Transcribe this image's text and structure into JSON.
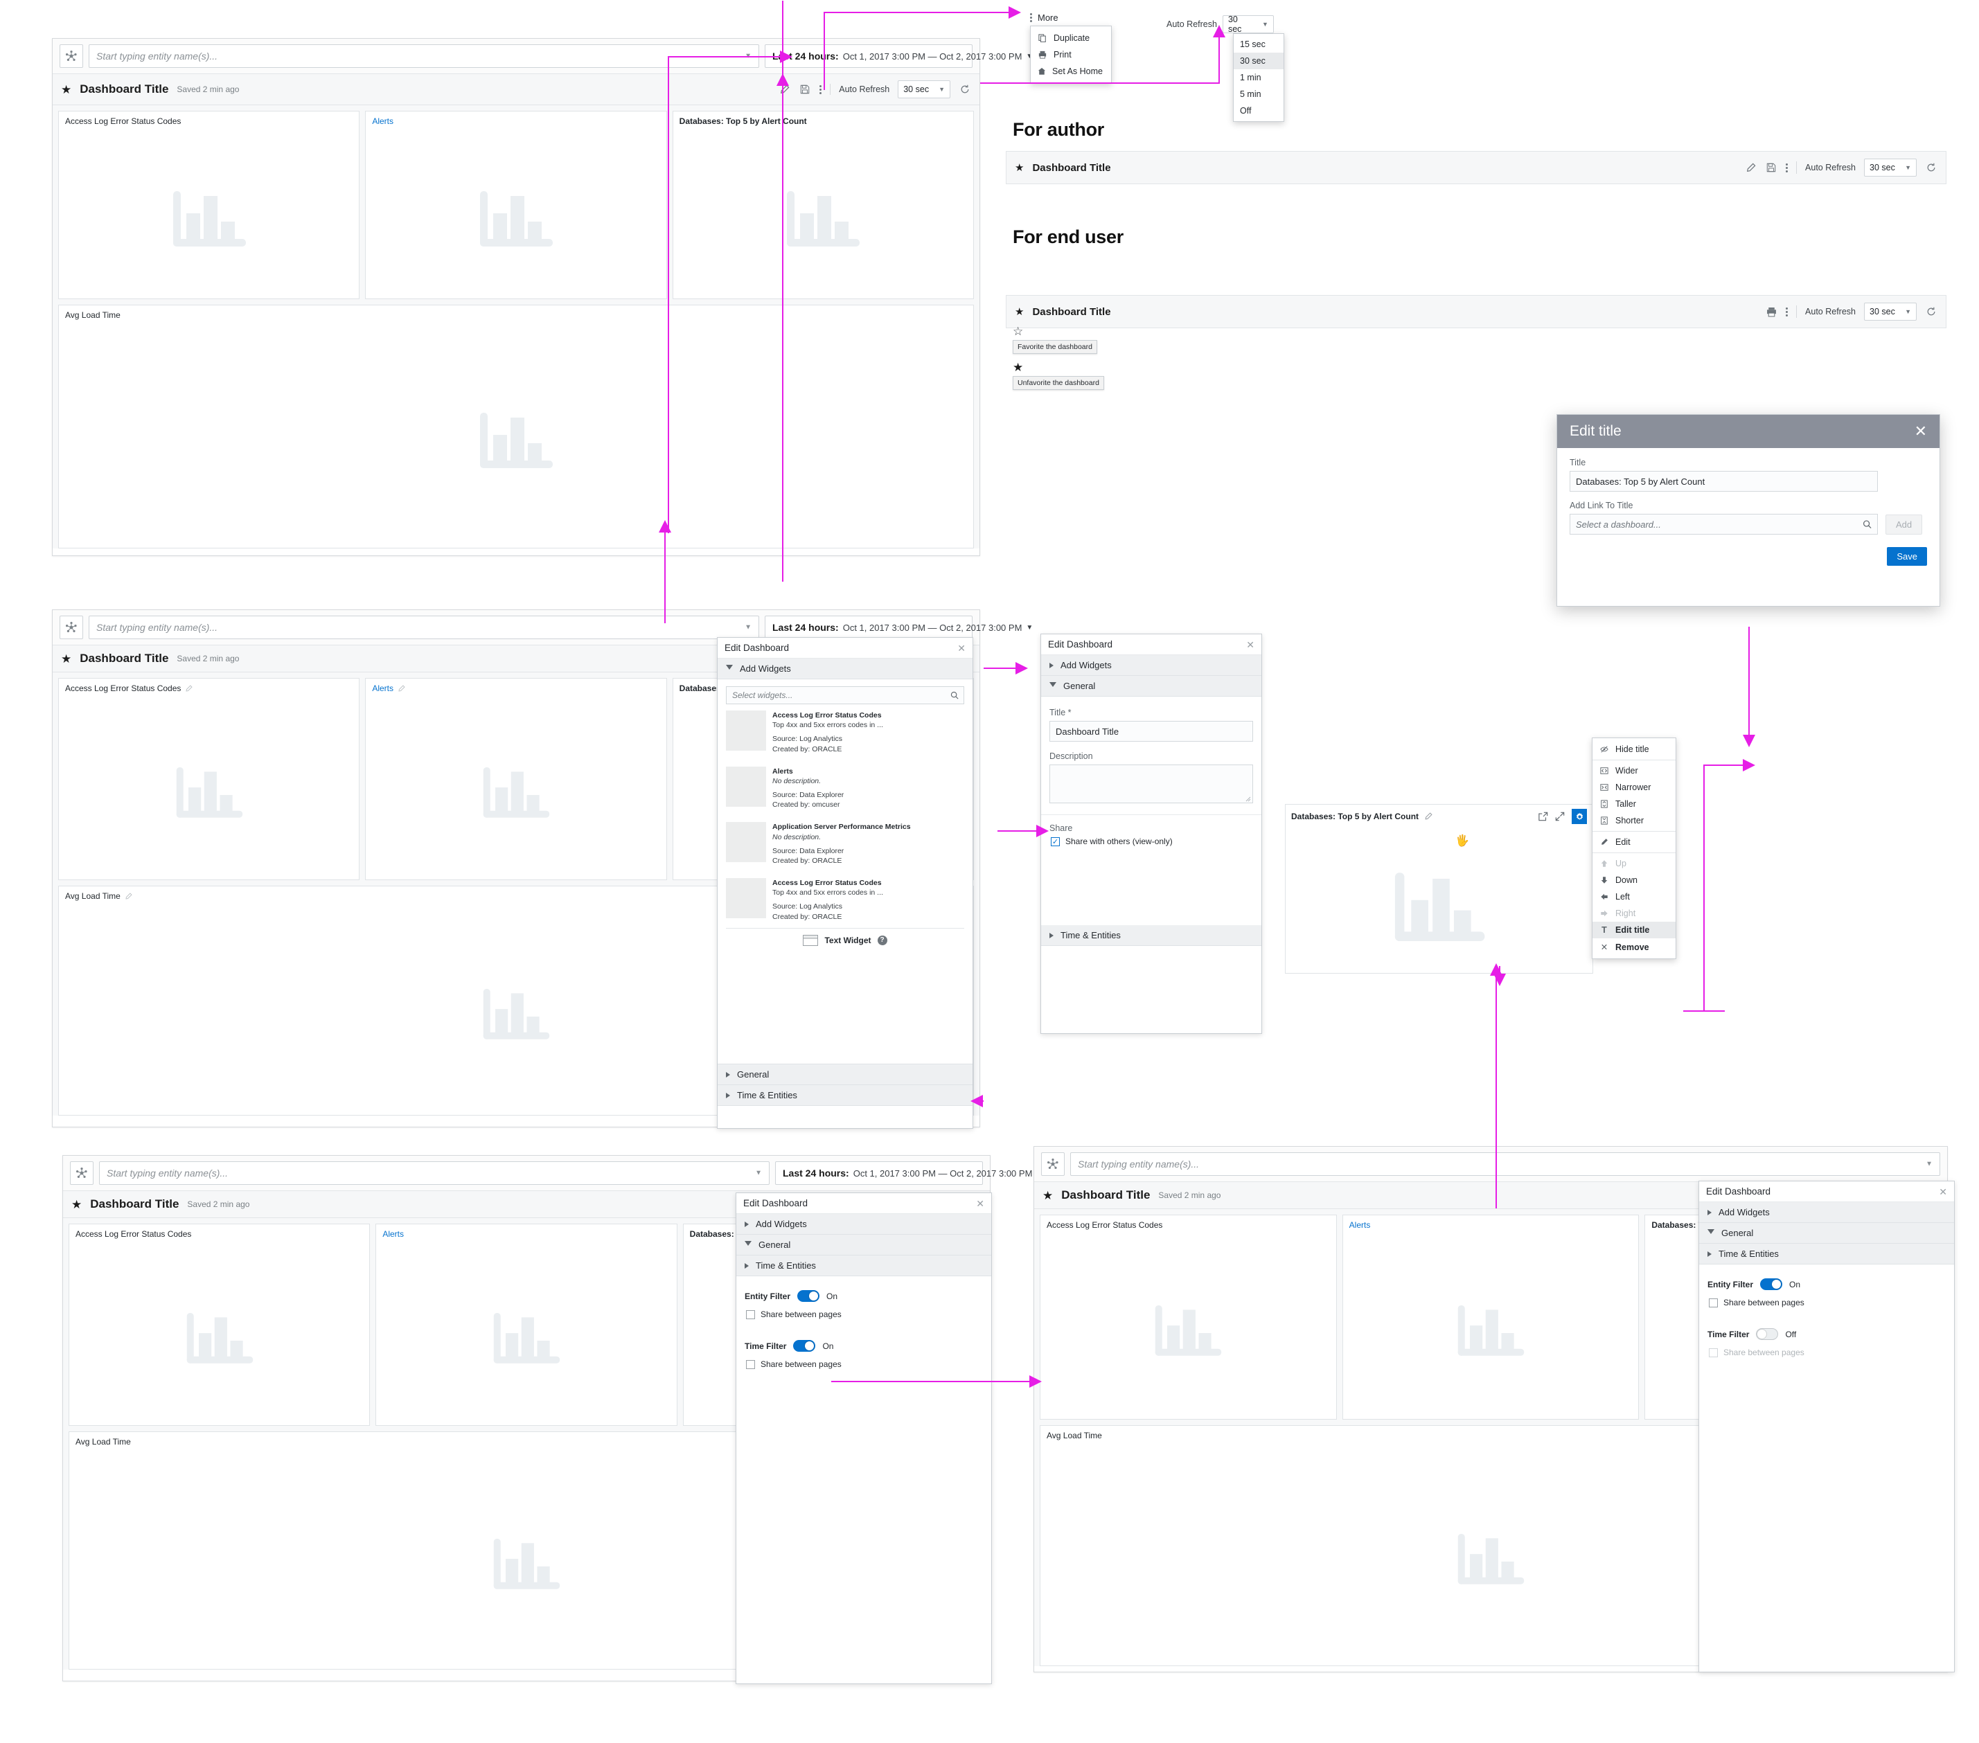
{
  "filter_bar": {
    "entity_icon": "topology-icon",
    "entity_placeholder": "Start typing entity name(s)...",
    "time_prefix": "Last 24 hours:",
    "time_range": "Oct 1, 2017 3:00 PM — Oct 2, 2017 3:00 PM"
  },
  "dashboard": {
    "title": "Dashboard Title",
    "saved": "Saved 2 min ago",
    "star_icon": "star-filled-icon",
    "edit_icon": "pencil-icon",
    "save_icon": "floppy-disk-icon",
    "more_icon": "kebab-icon",
    "print_icon": "printer-icon",
    "refresh_icon": "refresh-icon",
    "auto_refresh_label": "Auto Refresh",
    "auto_refresh_value": "30 sec"
  },
  "widgets": [
    {
      "title": "Access Log Error Status Codes",
      "style": "plain"
    },
    {
      "title": "Alerts",
      "style": "link"
    },
    {
      "title": "Databases: Top 5 by Alert Count",
      "style": "bold"
    },
    {
      "title": "Avg Load Time",
      "style": "plain"
    }
  ],
  "more_menu": {
    "label": "More",
    "icon": "kebab-icon",
    "items": [
      {
        "label": "Duplicate",
        "icon": "duplicate-icon"
      },
      {
        "label": "Print",
        "icon": "printer-icon"
      },
      {
        "label": "Set As Home",
        "icon": "home-icon"
      }
    ]
  },
  "auto_refresh_menu": {
    "label": "Auto Refresh",
    "value": "30 sec",
    "options": [
      "15 sec",
      "30 sec",
      "1 min",
      "5 min",
      "Off"
    ],
    "selected": "30 sec"
  },
  "sections": {
    "for_author": "For author",
    "for_end_user": "For end user"
  },
  "favorite": {
    "empty_star_icon": "star-outline-icon",
    "empty_tooltip": "Favorite the dashboard",
    "filled_star_icon": "star-filled-icon",
    "filled_tooltip": "Unfavorite the dashboard"
  },
  "edit_title_modal": {
    "heading": "Edit title",
    "close_icon": "close-icon",
    "title_label": "Title",
    "title_value": "Databases: Top 5 by Alert Count",
    "link_label": "Add Link To Title",
    "link_placeholder": "Select a dashboard...",
    "search_icon": "search-icon",
    "add_button": "Add",
    "save_button": "Save",
    "accent": "#0572ce"
  },
  "edit_panel": {
    "heading": "Edit Dashboard",
    "close_icon": "close-icon",
    "sections": {
      "add_widgets": "Add Widgets",
      "general": "General",
      "time_entities": "Time & Entities"
    },
    "widget_search_placeholder": "Select widgets...",
    "widget_list": [
      {
        "name": "Access Log Error Status Codes",
        "description": "Top 4xx and 5xx errors codes in ...",
        "source": "Source: Log Analytics",
        "created_by": "Created by: ORACLE"
      },
      {
        "name": "Alerts",
        "description": "No description.",
        "source": "Source: Data Explorer",
        "created_by": "Created by: omcuser"
      },
      {
        "name": "Application Server Performance Metrics",
        "description": "No description.",
        "source": "Source: Data Explorer",
        "created_by": "Created by: ORACLE"
      },
      {
        "name": "Access Log Error Status Codes",
        "description": "Top 4xx and 5xx errors codes in ...",
        "source": "Source: Log Analytics",
        "created_by": "Created by: ORACLE"
      }
    ],
    "text_widget": {
      "label": "Text Widget",
      "help_icon": "help-icon"
    },
    "general": {
      "title_label": "Title *",
      "title_value": "Dashboard Title",
      "description_label": "Description",
      "description_value": "",
      "share_label": "Share",
      "share_checkbox": "Share with others (view-only)",
      "share_checked": true
    },
    "time_entities": {
      "entity_filter_label": "Entity Filter",
      "entity_filter_state": "On",
      "entity_share": "Share between pages",
      "time_filter_label": "Time Filter",
      "time_filter_state_on": "On",
      "time_filter_state_off": "Off",
      "time_share": "Share between pages"
    }
  },
  "widget_menu": {
    "items": [
      {
        "label": "Hide title",
        "icon": "eye-slash-icon",
        "state": "normal"
      },
      {
        "label": "Wider",
        "icon": "wider-icon",
        "state": "normal"
      },
      {
        "label": "Narrower",
        "icon": "narrower-icon",
        "state": "normal"
      },
      {
        "label": "Taller",
        "icon": "taller-icon",
        "state": "normal"
      },
      {
        "label": "Shorter",
        "icon": "shorter-icon",
        "state": "normal"
      },
      {
        "label": "Edit",
        "icon": "pencil-icon",
        "state": "normal"
      },
      {
        "label": "Up",
        "icon": "arrow-up-icon",
        "state": "disabled"
      },
      {
        "label": "Down",
        "icon": "arrow-down-icon",
        "state": "normal"
      },
      {
        "label": "Left",
        "icon": "arrow-left-icon",
        "state": "normal"
      },
      {
        "label": "Right",
        "icon": "arrow-right-icon",
        "state": "disabled"
      },
      {
        "label": "Edit title",
        "icon": "text-icon",
        "state": "selected"
      },
      {
        "label": "Remove",
        "icon": "close-icon",
        "state": "normal"
      }
    ]
  },
  "widget_card": {
    "title": "Databases: Top 5 by Alert Count",
    "edit_title_icon": "pencil-icon",
    "popout_icon": "external-link-icon",
    "expand_icon": "expand-icon",
    "gear_icon": "gear-icon",
    "cursor_icon": "grab-hand-icon"
  }
}
